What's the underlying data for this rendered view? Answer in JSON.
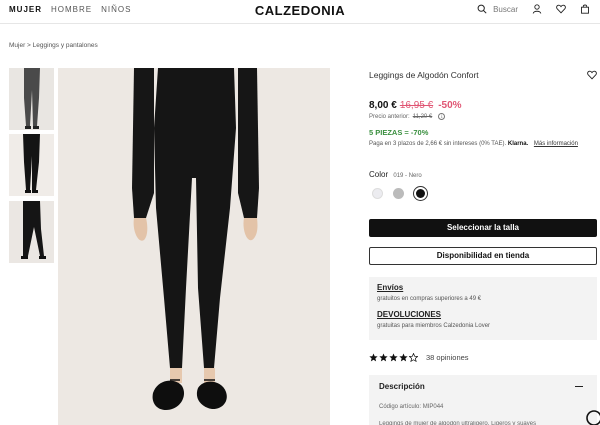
{
  "nav": {
    "items": [
      {
        "label": "MUJER",
        "active": true
      },
      {
        "label": "HOMBRE",
        "active": false
      },
      {
        "label": "NIÑOS",
        "active": false
      }
    ]
  },
  "brand": {
    "logo": "CALZEDONIA"
  },
  "header": {
    "search_label": "Buscar",
    "icons": [
      "search-icon",
      "user-icon",
      "heart-icon",
      "bag-icon"
    ]
  },
  "breadcrumb": "Mujer > Leggings y pantalones",
  "product": {
    "title": "Leggings de Algodón Confort",
    "price": "8,00 €",
    "old_price": "16,95 €",
    "discount": "-50%",
    "previous_price_label": "Precio anterior:",
    "previous_price_value": "11,20 €",
    "promo": "5 PIEZAS = -70%",
    "klarna_text": "Paga en 3 plazos de 2,66 € sin intereses (0% TAE).",
    "klarna_brand": "Klarna.",
    "klarna_more": "Más información",
    "color_label": "Color",
    "color_value": "019 - Nero",
    "colors": [
      "#ececf0",
      "#bbbbbb",
      "#111111"
    ],
    "select_size_label": "Seleccionar la talla",
    "availability_label": "Disponibilidad en tienda"
  },
  "shipping": {
    "title1": "Envíos",
    "text1": "gratuitos en compras superiores a 49 €",
    "title2": "DEVOLUCIONES",
    "text2": "gratuitas para miembros Calzedonia Lover"
  },
  "rating": {
    "stars": 4,
    "max": 5,
    "reviews": "38 opiniones"
  },
  "description": {
    "header": "Descripción",
    "code": "Código artículo: MIP044",
    "text_cut": "Leggings de mujer de algodón ultraligero. Ligeros y suaves"
  },
  "colors": {
    "accent_pink": "#e05573",
    "promo_green": "#3a8f3f",
    "dark": "#111111"
  }
}
